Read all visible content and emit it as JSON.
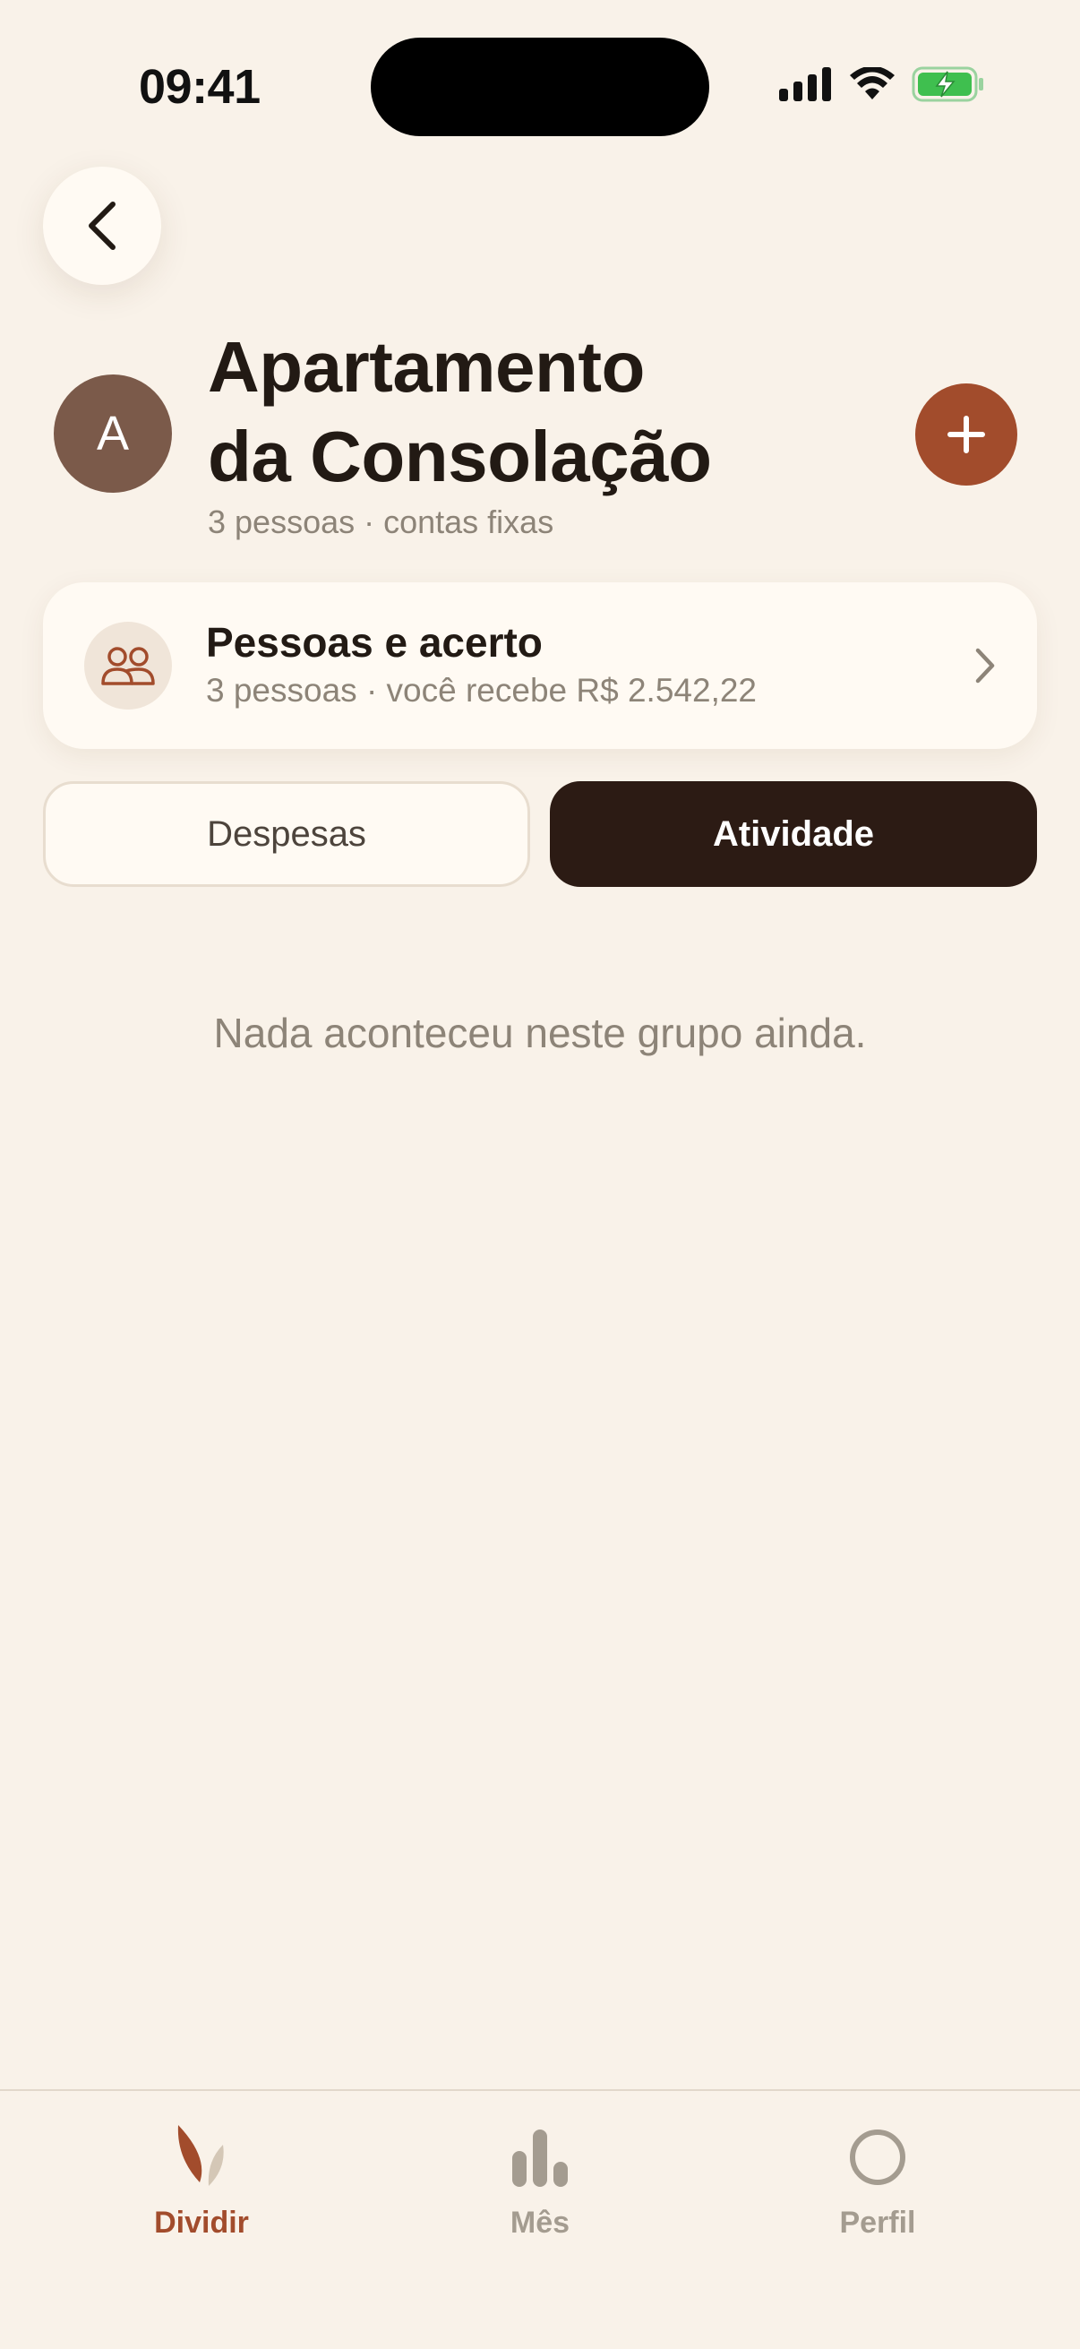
{
  "status_bar": {
    "time": "09:41",
    "icons": [
      "cellular-signal-icon",
      "wifi-icon",
      "battery-charging-icon"
    ]
  },
  "header": {
    "back_icon": "chevron-left-icon",
    "avatar_letter": "A",
    "title_line1": "Apartamento",
    "title_line2": "da Consolação",
    "subtitle": "3 pessoas · contas fixas",
    "add_icon": "plus-icon"
  },
  "people_card": {
    "icon": "people-icon",
    "title": "Pessoas e acerto",
    "subtitle": "3 pessoas · você recebe R$ 2.542,22",
    "chevron_icon": "chevron-right-icon"
  },
  "tabs": [
    {
      "label": "Despesas",
      "active": false
    },
    {
      "label": "Atividade",
      "active": true
    }
  ],
  "empty_state": "Nada aconteceu neste grupo ainda.",
  "bottom_nav": [
    {
      "label": "Dividir",
      "icon": "leaf-icon",
      "active": true
    },
    {
      "label": "Mês",
      "icon": "bar-chart-icon",
      "active": false
    },
    {
      "label": "Perfil",
      "icon": "circle-icon",
      "active": false
    }
  ],
  "colors": {
    "background": "#f9f2e9",
    "accent": "#a24c2c",
    "dark": "#2c1b14",
    "muted": "#8d8478"
  }
}
